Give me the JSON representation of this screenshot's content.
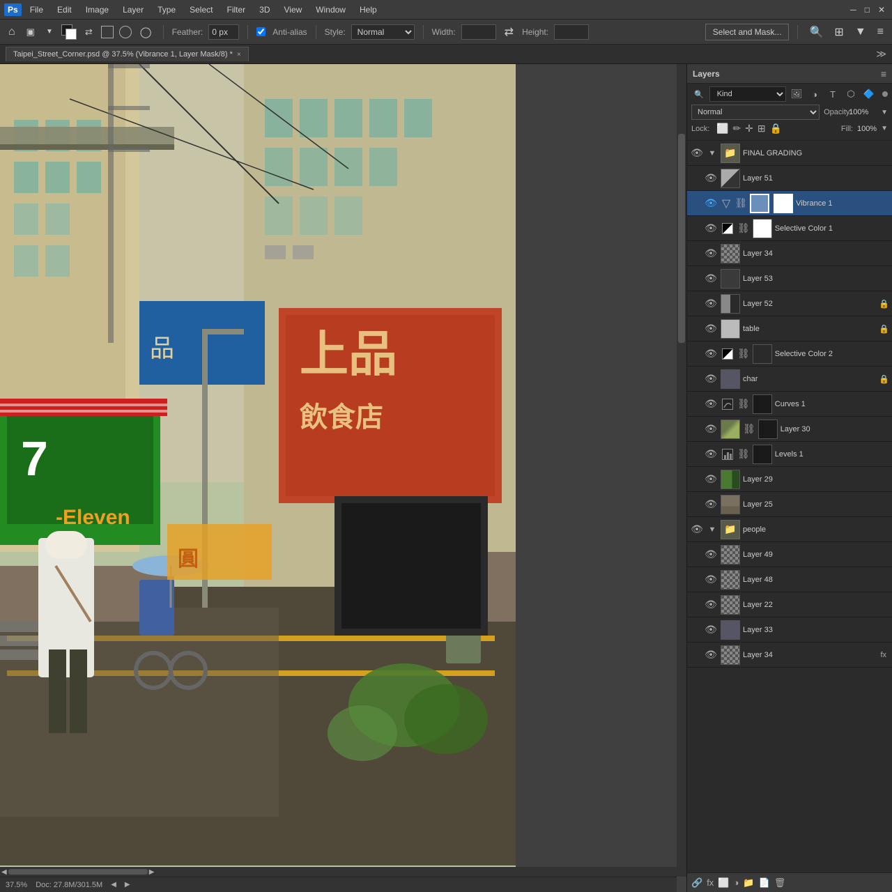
{
  "app": {
    "title": "Adobe Photoshop",
    "icon": "Ps"
  },
  "menubar": {
    "items": [
      "Ps",
      "File",
      "Edit",
      "Image",
      "Layer",
      "Type",
      "Select",
      "Filter",
      "3D",
      "View",
      "Window",
      "Help"
    ]
  },
  "toolbar": {
    "feather_label": "Feather:",
    "feather_value": "0 px",
    "antialias_label": "Anti-alias",
    "style_label": "Style:",
    "style_value": "Normal",
    "width_label": "Width:",
    "height_label": "Height:",
    "select_mask_btn": "Select and Mask..."
  },
  "tabbar": {
    "tab_title": "Taipei_Street_Corner.psd @ 37.5% (Vibrance 1, Layer Mask/8) *",
    "close": "×"
  },
  "statusbar": {
    "zoom": "37.5%",
    "doc": "Doc: 27.8M/301.5M"
  },
  "layers_panel": {
    "title": "Layers",
    "search_placeholder": "Kind",
    "blend_mode": "Normal",
    "opacity_label": "Opacity:",
    "opacity_value": "100%",
    "fill_label": "Fill:",
    "fill_value": "100%",
    "lock_label": "Lock:",
    "layers": [
      {
        "id": "final-grading",
        "name": "FINAL GRADING",
        "type": "group",
        "visible": true,
        "indent": 0,
        "expanded": true
      },
      {
        "id": "layer-51",
        "name": "Layer 51",
        "type": "layer",
        "visible": true,
        "indent": 1,
        "thumb": "mixed"
      },
      {
        "id": "vibrance-1",
        "name": "Vibrance 1",
        "type": "adjustment",
        "visible": true,
        "indent": 1,
        "selected": true,
        "thumb": "white",
        "has_mask": true
      },
      {
        "id": "selective-color-1",
        "name": "Selective Color 1",
        "type": "adjustment",
        "visible": true,
        "indent": 1,
        "thumb": "white",
        "has_mask": true
      },
      {
        "id": "layer-34a",
        "name": "Layer 34",
        "type": "layer",
        "visible": true,
        "indent": 1,
        "thumb": "checkered"
      },
      {
        "id": "layer-53",
        "name": "Layer 53",
        "type": "layer",
        "visible": true,
        "indent": 1,
        "thumb": "dark"
      },
      {
        "id": "layer-52",
        "name": "Layer 52",
        "type": "layer",
        "visible": true,
        "indent": 1,
        "thumb": "mixed",
        "locked": true
      },
      {
        "id": "table",
        "name": "table",
        "type": "layer",
        "visible": true,
        "indent": 1,
        "thumb": "light",
        "locked": true
      },
      {
        "id": "selective-color-2",
        "name": "Selective Color 2",
        "type": "adjustment",
        "visible": true,
        "indent": 1,
        "thumb": "dark",
        "has_mask": true
      },
      {
        "id": "char",
        "name": "char",
        "type": "layer",
        "visible": true,
        "indent": 1,
        "thumb": "person",
        "locked": true
      },
      {
        "id": "curves-1",
        "name": "Curves 1",
        "type": "adjustment",
        "visible": true,
        "indent": 1,
        "thumb": "dark",
        "has_mask": true
      },
      {
        "id": "layer-30",
        "name": "Layer 30",
        "type": "layer",
        "visible": true,
        "indent": 1,
        "thumb": "mixed",
        "has_mask": true
      },
      {
        "id": "levels-1",
        "name": "Levels 1",
        "type": "adjustment",
        "visible": true,
        "indent": 1,
        "thumb": "dark",
        "has_mask": true
      },
      {
        "id": "layer-29",
        "name": "Layer 29",
        "type": "layer",
        "visible": true,
        "indent": 1,
        "thumb": "green"
      },
      {
        "id": "layer-25",
        "name": "Layer 25",
        "type": "layer",
        "visible": true,
        "indent": 1,
        "thumb": "gray"
      },
      {
        "id": "people",
        "name": "people",
        "type": "group",
        "visible": true,
        "indent": 0,
        "expanded": true
      },
      {
        "id": "layer-49",
        "name": "Layer 49",
        "type": "layer",
        "visible": true,
        "indent": 1,
        "thumb": "checkered"
      },
      {
        "id": "layer-48",
        "name": "Layer 48",
        "type": "layer",
        "visible": true,
        "indent": 1,
        "thumb": "checkered"
      },
      {
        "id": "layer-22",
        "name": "Layer 22",
        "type": "layer",
        "visible": true,
        "indent": 1,
        "thumb": "checkered"
      },
      {
        "id": "layer-33",
        "name": "Layer 33",
        "type": "layer",
        "visible": true,
        "indent": 1,
        "thumb": "person"
      },
      {
        "id": "layer-34b",
        "name": "Layer 34",
        "type": "layer",
        "visible": true,
        "indent": 1,
        "thumb": "checkered"
      }
    ]
  },
  "panel_bottom": {
    "buttons": [
      "link-icon",
      "new-style-icon",
      "mask-icon",
      "adjustment-icon",
      "folder-icon",
      "new-layer-icon",
      "delete-icon"
    ]
  }
}
